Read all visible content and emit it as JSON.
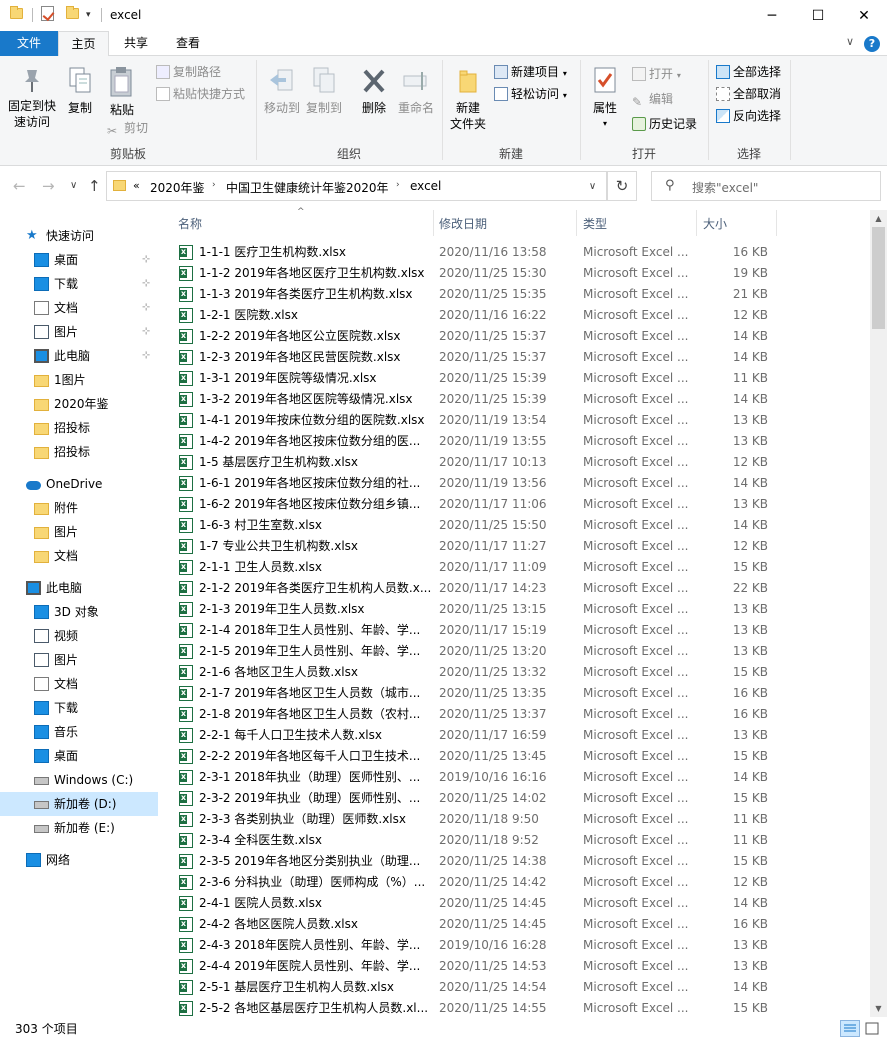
{
  "window": {
    "title": "excel",
    "minimize_icon": "─",
    "maximize_icon": "☐",
    "close_icon": "✕",
    "qat_dropdown": "▾"
  },
  "ribbon_tabs": {
    "file": "文件",
    "home": "主页",
    "share": "共享",
    "view": "查看",
    "help_icon": "?"
  },
  "ribbon": {
    "clipboard": {
      "label": "剪贴板",
      "pin": "固定到快\n速访问",
      "copy": "复制",
      "paste": "粘贴",
      "copy_path": "复制路径",
      "paste_shortcut": "粘贴快捷方式",
      "cut": "剪切"
    },
    "organize": {
      "label": "组织",
      "move_to": "移动到",
      "copy_to": "复制到",
      "delete": "删除",
      "rename": "重命名"
    },
    "new": {
      "label": "新建",
      "new_folder": "新建\n文件夹",
      "new_item": "新建项目",
      "easy_access": "轻松访问"
    },
    "open": {
      "label": "打开",
      "properties": "属性",
      "open": "打开",
      "edit": "编辑",
      "history": "历史记录"
    },
    "select": {
      "label": "选择",
      "select_all": "全部选择",
      "select_none": "全部取消",
      "invert": "反向选择"
    }
  },
  "address": {
    "prefix": "«",
    "crumbs": [
      "2020年鉴",
      "中国卫生健康统计年鉴2020年",
      "excel"
    ],
    "separator": "›",
    "dropdown_icon": "∨",
    "refresh_icon": "↻",
    "search_icon": "⚲",
    "search_placeholder": "搜索\"excel\""
  },
  "nav_arrows": {
    "back": "←",
    "forward": "→",
    "recent": "∨",
    "up": "↑"
  },
  "nav_pane": {
    "items": [
      {
        "label": "快速访问",
        "icon": "star-icon",
        "level": 0
      },
      {
        "label": "桌面",
        "icon": "desktop-icon",
        "level": 1,
        "pinned": true
      },
      {
        "label": "下载",
        "icon": "download-icon",
        "level": 1,
        "pinned": true
      },
      {
        "label": "文档",
        "icon": "documents-icon",
        "level": 1,
        "pinned": true
      },
      {
        "label": "图片",
        "icon": "pictures-icon",
        "level": 1,
        "pinned": true
      },
      {
        "label": "此电脑",
        "icon": "computer-icon",
        "level": 1,
        "pinned": true
      },
      {
        "label": "1图片",
        "icon": "folder-icon",
        "level": 1
      },
      {
        "label": "2020年鉴",
        "icon": "folder-icon",
        "level": 1
      },
      {
        "label": "招投标",
        "icon": "folder-icon",
        "level": 1
      },
      {
        "label": "招投标",
        "icon": "folder-icon",
        "level": 1
      },
      {
        "label": "",
        "icon": "",
        "level": -1
      },
      {
        "label": "OneDrive",
        "icon": "cloud-icon",
        "level": 0
      },
      {
        "label": "附件",
        "icon": "folder-icon",
        "level": 1
      },
      {
        "label": "图片",
        "icon": "folder-icon",
        "level": 1
      },
      {
        "label": "文档",
        "icon": "folder-icon",
        "level": 1
      },
      {
        "label": "",
        "icon": "",
        "level": -1
      },
      {
        "label": "此电脑",
        "icon": "computer-icon",
        "level": 0
      },
      {
        "label": "3D 对象",
        "icon": "3d-objects-icon",
        "level": 1
      },
      {
        "label": "视频",
        "icon": "video-icon",
        "level": 1
      },
      {
        "label": "图片",
        "icon": "pictures-icon",
        "level": 1
      },
      {
        "label": "文档",
        "icon": "documents-icon",
        "level": 1
      },
      {
        "label": "下载",
        "icon": "download-icon",
        "level": 1
      },
      {
        "label": "音乐",
        "icon": "music-icon",
        "level": 1
      },
      {
        "label": "桌面",
        "icon": "desktop-icon",
        "level": 1
      },
      {
        "label": "Windows (C:)",
        "icon": "drive-icon",
        "level": 1
      },
      {
        "label": "新加卷 (D:)",
        "icon": "drive-icon",
        "level": 1,
        "selected": true
      },
      {
        "label": "新加卷 (E:)",
        "icon": "drive-icon",
        "level": 1
      },
      {
        "label": "",
        "icon": "",
        "level": -1
      },
      {
        "label": "网络",
        "icon": "network-icon",
        "level": 0
      }
    ],
    "pin_icon": "📌"
  },
  "columns": {
    "name": "名称",
    "date": "修改日期",
    "type": "类型",
    "size": "大小",
    "sort_icon": "^"
  },
  "files": [
    {
      "name": "1-1-1 医疗卫生机构数.xlsx",
      "date": "2020/11/16 13:58",
      "type": "Microsoft Excel ...",
      "size": "16 KB"
    },
    {
      "name": "1-1-2 2019年各地区医疗卫生机构数.xlsx",
      "date": "2020/11/25 15:30",
      "type": "Microsoft Excel ...",
      "size": "19 KB"
    },
    {
      "name": "1-1-3 2019年各类医疗卫生机构数.xlsx",
      "date": "2020/11/25 15:35",
      "type": "Microsoft Excel ...",
      "size": "21 KB"
    },
    {
      "name": "1-2-1 医院数.xlsx",
      "date": "2020/11/16 16:22",
      "type": "Microsoft Excel ...",
      "size": "12 KB"
    },
    {
      "name": "1-2-2 2019年各地区公立医院数.xlsx",
      "date": "2020/11/25 15:37",
      "type": "Microsoft Excel ...",
      "size": "14 KB"
    },
    {
      "name": "1-2-3 2019年各地区民营医院数.xlsx",
      "date": "2020/11/25 15:37",
      "type": "Microsoft Excel ...",
      "size": "14 KB"
    },
    {
      "name": "1-3-1 2019年医院等级情况.xlsx",
      "date": "2020/11/25 15:39",
      "type": "Microsoft Excel ...",
      "size": "11 KB"
    },
    {
      "name": "1-3-2 2019年各地区医院等级情况.xlsx",
      "date": "2020/11/25 15:39",
      "type": "Microsoft Excel ...",
      "size": "14 KB"
    },
    {
      "name": "1-4-1 2019年按床位数分组的医院数.xlsx",
      "date": "2020/11/19 13:54",
      "type": "Microsoft Excel ...",
      "size": "13 KB"
    },
    {
      "name": "1-4-2 2019年各地区按床位数分组的医...",
      "date": "2020/11/19 13:55",
      "type": "Microsoft Excel ...",
      "size": "13 KB"
    },
    {
      "name": "1-5 基层医疗卫生机构数.xlsx",
      "date": "2020/11/17 10:13",
      "type": "Microsoft Excel ...",
      "size": "12 KB"
    },
    {
      "name": "1-6-1 2019年各地区按床位数分组的社...",
      "date": "2020/11/19 13:56",
      "type": "Microsoft Excel ...",
      "size": "14 KB"
    },
    {
      "name": "1-6-2 2019年各地区按床位数分组乡镇...",
      "date": "2020/11/17 11:06",
      "type": "Microsoft Excel ...",
      "size": "13 KB"
    },
    {
      "name": "1-6-3 村卫生室数.xlsx",
      "date": "2020/11/25 15:50",
      "type": "Microsoft Excel ...",
      "size": "14 KB"
    },
    {
      "name": "1-7 专业公共卫生机构数.xlsx",
      "date": "2020/11/17 11:27",
      "type": "Microsoft Excel ...",
      "size": "12 KB"
    },
    {
      "name": "2-1-1 卫生人员数.xlsx",
      "date": "2020/11/17 11:09",
      "type": "Microsoft Excel ...",
      "size": "15 KB"
    },
    {
      "name": "2-1-2 2019年各类医疗卫生机构人员数.x...",
      "date": "2020/11/17 14:23",
      "type": "Microsoft Excel ...",
      "size": "22 KB"
    },
    {
      "name": "2-1-3 2019年卫生人员数.xlsx",
      "date": "2020/11/25 13:15",
      "type": "Microsoft Excel ...",
      "size": "13 KB"
    },
    {
      "name": "2-1-4 2018年卫生人员性别、年龄、学...",
      "date": "2020/11/17 15:19",
      "type": "Microsoft Excel ...",
      "size": "13 KB"
    },
    {
      "name": "2-1-5 2019年卫生人员性别、年龄、学...",
      "date": "2020/11/25 13:20",
      "type": "Microsoft Excel ...",
      "size": "13 KB"
    },
    {
      "name": "2-1-6 各地区卫生人员数.xlsx",
      "date": "2020/11/25 13:32",
      "type": "Microsoft Excel ...",
      "size": "15 KB"
    },
    {
      "name": "2-1-7 2019年各地区卫生人员数（城市...",
      "date": "2020/11/25 13:35",
      "type": "Microsoft Excel ...",
      "size": "16 KB"
    },
    {
      "name": "2-1-8 2019年各地区卫生人员数（农村...",
      "date": "2020/11/25 13:37",
      "type": "Microsoft Excel ...",
      "size": "16 KB"
    },
    {
      "name": "2-2-1 每千人口卫生技术人数.xlsx",
      "date": "2020/11/17 16:59",
      "type": "Microsoft Excel ...",
      "size": "13 KB"
    },
    {
      "name": "2-2-2 2019年各地区每千人口卫生技术...",
      "date": "2020/11/25 13:45",
      "type": "Microsoft Excel ...",
      "size": "15 KB"
    },
    {
      "name": "2-3-1 2018年执业（助理）医师性别、...",
      "date": "2019/10/16 16:16",
      "type": "Microsoft Excel ...",
      "size": "14 KB"
    },
    {
      "name": "2-3-2 2019年执业（助理）医师性别、...",
      "date": "2020/11/25 14:02",
      "type": "Microsoft Excel ...",
      "size": "15 KB"
    },
    {
      "name": "2-3-3 各类别执业（助理）医师数.xlsx",
      "date": "2020/11/18 9:50",
      "type": "Microsoft Excel ...",
      "size": "11 KB"
    },
    {
      "name": "2-3-4 全科医生数.xlsx",
      "date": "2020/11/18 9:52",
      "type": "Microsoft Excel ...",
      "size": "11 KB"
    },
    {
      "name": "2-3-5 2019年各地区分类别执业（助理...",
      "date": "2020/11/25 14:38",
      "type": "Microsoft Excel ...",
      "size": "15 KB"
    },
    {
      "name": "2-3-6 分科执业（助理）医师构成（%）...",
      "date": "2020/11/25 14:42",
      "type": "Microsoft Excel ...",
      "size": "12 KB"
    },
    {
      "name": "2-4-1 医院人员数.xlsx",
      "date": "2020/11/25 14:45",
      "type": "Microsoft Excel ...",
      "size": "14 KB"
    },
    {
      "name": "2-4-2 各地区医院人员数.xlsx",
      "date": "2020/11/25 14:45",
      "type": "Microsoft Excel ...",
      "size": "16 KB"
    },
    {
      "name": "2-4-3 2018年医院人员性别、年龄、学...",
      "date": "2019/10/16 16:28",
      "type": "Microsoft Excel ...",
      "size": "13 KB"
    },
    {
      "name": "2-4-4 2019年医院人员性别、年龄、学...",
      "date": "2020/11/25 14:53",
      "type": "Microsoft Excel ...",
      "size": "13 KB"
    },
    {
      "name": "2-5-1 基层医疗卫生机构人员数.xlsx",
      "date": "2020/11/25 14:54",
      "type": "Microsoft Excel ...",
      "size": "14 KB"
    },
    {
      "name": "2-5-2 各地区基层医疗卫生机构人员数.xl...",
      "date": "2020/11/25 14:55",
      "type": "Microsoft Excel ...",
      "size": "15 KB"
    }
  ],
  "status": {
    "item_count": "303 个项目"
  }
}
